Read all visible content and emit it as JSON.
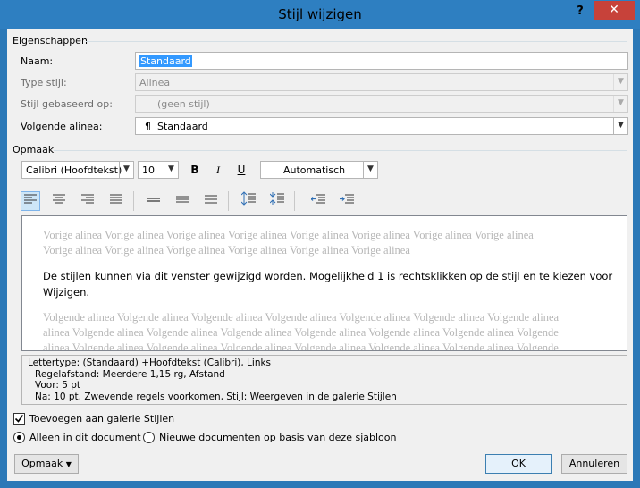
{
  "window": {
    "title": "Stijl wijzigen",
    "help": "?",
    "close": "✕"
  },
  "eigenschappen": {
    "header": "Eigenschappen",
    "naam_label": "Naam:",
    "naam_value": "Standaard",
    "type_label": "Type stijl:",
    "type_value": "Alinea",
    "gebaseerd_label": "Stijl gebaseerd op:",
    "gebaseerd_value": "(geen stijl)",
    "volgende_label": "Volgende alinea:",
    "volgende_icon": "¶",
    "volgende_value": "Standaard"
  },
  "opmaak": {
    "header": "Opmaak",
    "font": "Calibri (Hoofdtekst)",
    "size": "10",
    "bold": "B",
    "italic": "I",
    "underline": "U",
    "color": "Automatisch"
  },
  "preview": {
    "prev_line1": "Vorige alinea Vorige alinea Vorige alinea Vorige alinea Vorige alinea Vorige alinea Vorige alinea Vorige alinea",
    "prev_line2": "Vorige alinea Vorige alinea Vorige alinea Vorige alinea Vorige alinea Vorige alinea",
    "sample_line1": "De stijlen kunnen via dit venster gewijzigd worden. Mogelijkheid 1 is rechtsklikken op de stijl en te kiezen voor",
    "sample_line2": "Wijzigen.",
    "next_line1": "Volgende alinea Volgende alinea Volgende alinea Volgende alinea Volgende alinea Volgende alinea Volgende alinea",
    "next_line2": "alinea Volgende alinea Volgende alinea Volgende alinea Volgende alinea Volgende alinea Volgende alinea Volgende",
    "next_line3": "alinea Volgende alinea Volgende alinea Volgende alinea Volgende alinea Volgende alinea Volgende alinea Volgende"
  },
  "description": {
    "line1": "Lettertype: (Standaard) +Hoofdtekst (Calibri), Links",
    "line2": "Regelafstand:  Meerdere 1,15 rg, Afstand",
    "line3": "Voor:  5 pt",
    "line4": "Na:  10 pt, Zwevende regels voorkomen, Stijl: Weergeven in de galerie Stijlen"
  },
  "options": {
    "add_gallery": "Toevoegen aan galerie Stijlen",
    "only_document": "Alleen in dit document",
    "new_documents": "Nieuwe documenten op basis van deze sjabloon"
  },
  "buttons": {
    "opmaak": "Opmaak",
    "ok": "OK",
    "cancel": "Annuleren"
  }
}
